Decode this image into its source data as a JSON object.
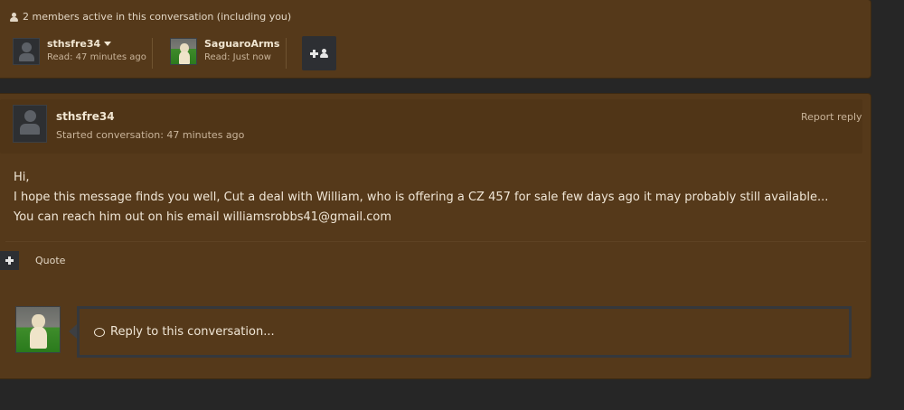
{
  "members": {
    "header_text": "2 members active in this conversation (including you)",
    "list": [
      {
        "name": "sthsfre34",
        "status": "Read: 47 minutes ago"
      },
      {
        "name": "SaguaroArms",
        "status": "Read: Just now"
      }
    ]
  },
  "message": {
    "author": "sthsfre34",
    "meta": "Started conversation: 47 minutes ago",
    "report_label": "Report reply",
    "body_line1": "Hi,",
    "body_line2": "I hope this message finds you well, Cut a deal with William, who is offering a CZ 457 for sale few days ago it may probably still available... You can reach him out on his email williamsrobbs41@gmail.com",
    "quote_label": "Quote"
  },
  "reply": {
    "placeholder": "Reply to this conversation..."
  },
  "colors": {
    "panel_bg": "#55391a",
    "page_bg": "#262626",
    "button_bg": "#2d2f33"
  }
}
